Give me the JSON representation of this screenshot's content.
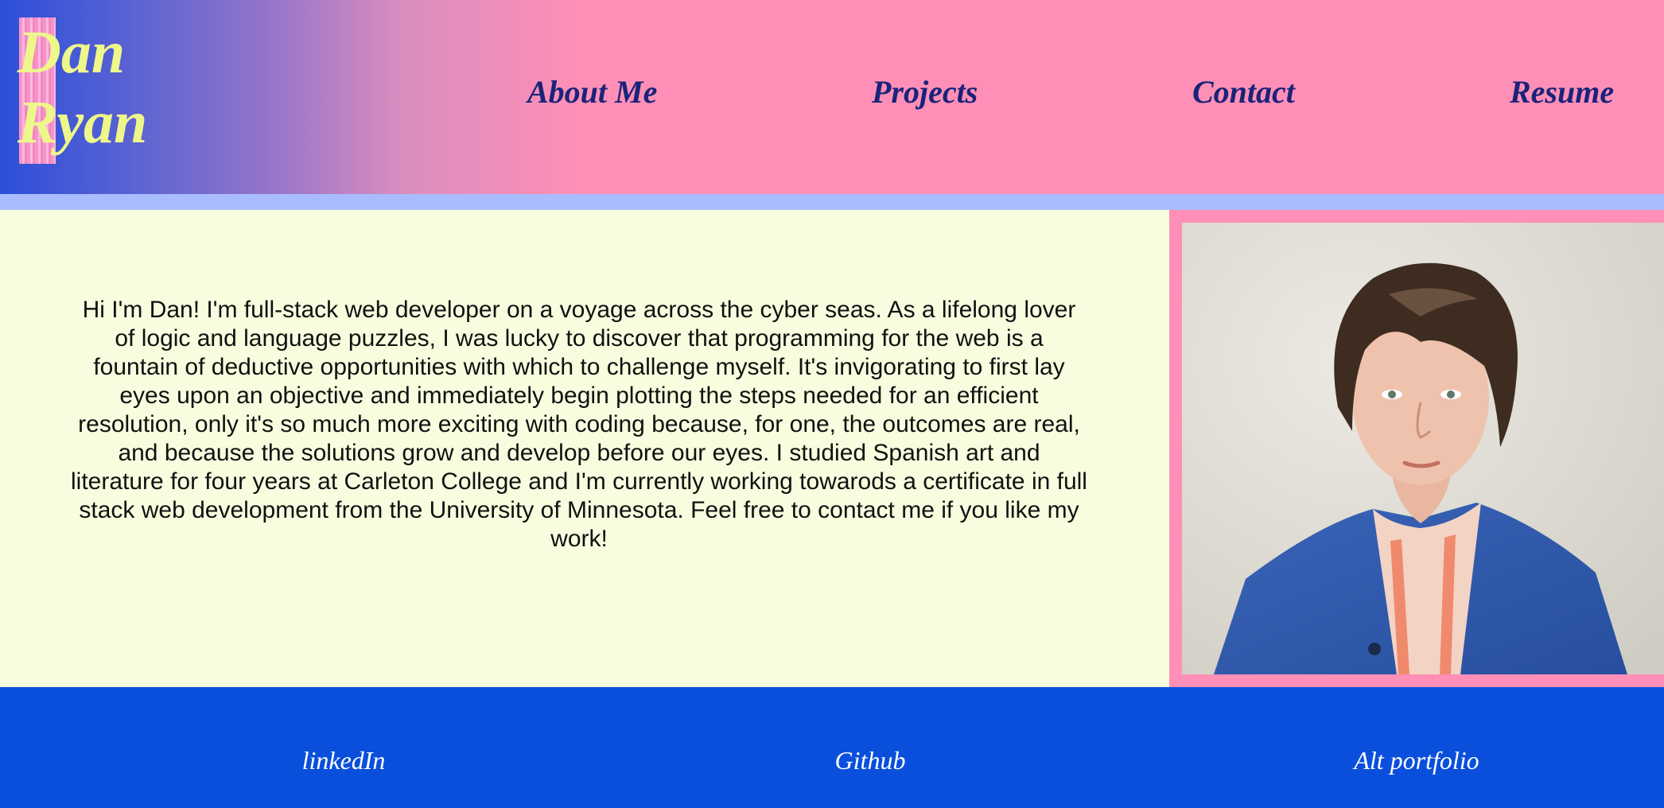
{
  "header": {
    "logo": {
      "first": "Dan",
      "last": "Ryan"
    },
    "nav": [
      {
        "label": "About Me"
      },
      {
        "label": "Projects"
      },
      {
        "label": "Contact"
      },
      {
        "label": "Resume"
      }
    ]
  },
  "main": {
    "bio": "Hi I'm Dan! I'm full-stack web developer on a voyage across the cyber seas. As a lifelong lover of logic and language puzzles, I was lucky to discover that programming for the web is a fountain of deductive opportunities with which to challenge myself. It's invigorating to first lay eyes upon an objective and immediately begin plotting the steps needed for an efficient resolution, only it's so much more exciting with coding because, for one, the outcomes are real, and because the solutions grow and develop before our eyes. I studied Spanish art and literature for four years at Carleton College and I'm currently working towarods a certificate in full stack web development from the University of Minnesota. Feel free to contact me if you like my work!"
  },
  "footer": {
    "links": [
      {
        "label": "linkedIn"
      },
      {
        "label": "Github"
      },
      {
        "label": "Alt portfolio"
      }
    ]
  },
  "colors": {
    "header_pink": "#ff8fb6",
    "header_blue": "#2b4fd8",
    "logo_yellow": "#eef78a",
    "nav_text": "#1a237a",
    "divider": "#a9bcff",
    "bio_background": "#f7fdde",
    "footer_blue": "#0a4fdc",
    "footer_text": "#ffffff"
  }
}
